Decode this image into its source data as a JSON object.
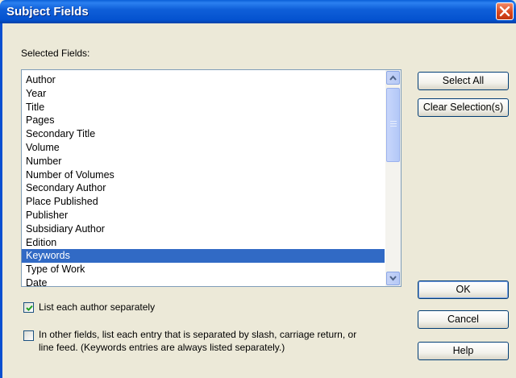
{
  "window": {
    "title": "Subject Fields"
  },
  "selected_fields_label": "Selected Fields:",
  "fields": [
    {
      "label": "Author",
      "selected": false
    },
    {
      "label": "Year",
      "selected": false
    },
    {
      "label": "Title",
      "selected": false
    },
    {
      "label": "Pages",
      "selected": false
    },
    {
      "label": "Secondary Title",
      "selected": false
    },
    {
      "label": "Volume",
      "selected": false
    },
    {
      "label": "Number",
      "selected": false
    },
    {
      "label": "Number of Volumes",
      "selected": false
    },
    {
      "label": "Secondary Author",
      "selected": false
    },
    {
      "label": "Place Published",
      "selected": false
    },
    {
      "label": "Publisher",
      "selected": false
    },
    {
      "label": "Subsidiary Author",
      "selected": false
    },
    {
      "label": "Edition",
      "selected": false
    },
    {
      "label": "Keywords",
      "selected": true
    },
    {
      "label": "Type of Work",
      "selected": false
    },
    {
      "label": "Date",
      "selected": false
    }
  ],
  "buttons": {
    "select_all": "Select All",
    "clear_selection": "Clear Selection(s)",
    "ok": "OK",
    "cancel": "Cancel",
    "help": "Help"
  },
  "options": {
    "list_each_author": {
      "label": "List each author separately",
      "checked": true
    },
    "list_each_entry": {
      "line1": "In other fields, list each entry that is separated by slash, carriage return, or",
      "line2": "line feed. (Keywords entries are always listed separately.)",
      "checked": false
    }
  },
  "colors": {
    "title_bar": "#0452cf",
    "selection": "#316ac5",
    "dialog_bg": "#ece9d8"
  }
}
